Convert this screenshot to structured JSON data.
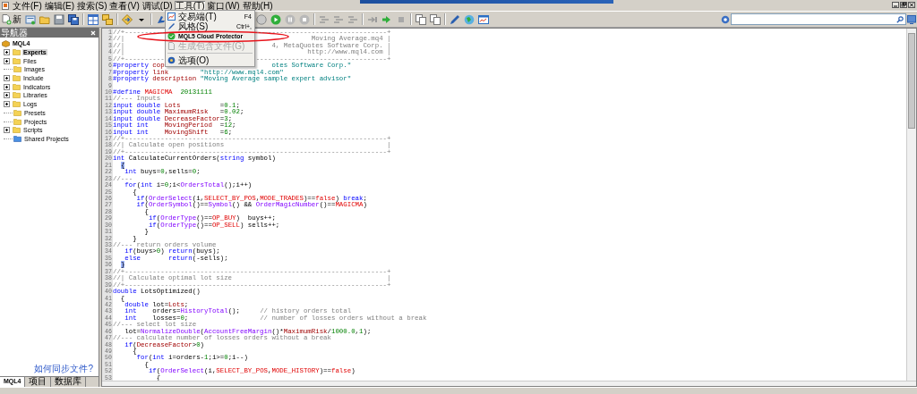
{
  "menu_bar": [
    {
      "label": "文件(F)",
      "selected": false
    },
    {
      "label": "编辑(E)",
      "selected": false
    },
    {
      "label": "搜索(S)",
      "selected": false
    },
    {
      "label": "查看(V)",
      "selected": false
    },
    {
      "label": "调试(D)",
      "selected": false
    },
    {
      "label": "工具(T)",
      "selected": true
    },
    {
      "label": "窗口(W)",
      "selected": false
    },
    {
      "label": "帮助(H)",
      "selected": false
    }
  ],
  "toolbar": {
    "left": [
      {
        "kind": "new-file",
        "label": "新"
      },
      {
        "kind": "new-doc"
      },
      {
        "kind": "folder"
      },
      {
        "kind": "disk"
      },
      {
        "kind": "disks"
      },
      {
        "kind": "separator"
      },
      {
        "kind": "panes"
      },
      {
        "kind": "panes-stack"
      },
      {
        "kind": "separator"
      },
      {
        "kind": "compile"
      },
      {
        "kind": "caret"
      },
      {
        "kind": "separator"
      },
      {
        "kind": "pin"
      }
    ],
    "right": [
      {
        "kind": "circle"
      },
      {
        "kind": "play"
      },
      {
        "kind": "pause"
      },
      {
        "kind": "stop"
      },
      {
        "kind": "separator"
      },
      {
        "kind": "lines"
      },
      {
        "kind": "lines"
      },
      {
        "kind": "lines"
      },
      {
        "kind": "separator"
      },
      {
        "kind": "step"
      },
      {
        "kind": "step-go"
      },
      {
        "kind": "square"
      },
      {
        "kind": "separator"
      },
      {
        "kind": "copy"
      },
      {
        "kind": "copy"
      },
      {
        "kind": "separator"
      },
      {
        "kind": "pen"
      },
      {
        "kind": "globe"
      },
      {
        "kind": "chart-window"
      }
    ]
  },
  "tools_menu": {
    "items": [
      {
        "kind": "item",
        "label": "交易端(T)",
        "shortcut": "F4",
        "disabled": false
      },
      {
        "kind": "item",
        "label": "风格(S)",
        "shortcut": "Ctrl+,",
        "disabled": false
      },
      {
        "kind": "plugin",
        "label": "MQL5 Cloud Protector",
        "disabled": false
      },
      {
        "kind": "item",
        "label": "生成包含文件(G)",
        "disabled": true
      },
      {
        "kind": "separator"
      },
      {
        "kind": "item",
        "label": "选项(O)",
        "disabled": false
      }
    ]
  },
  "navigator": {
    "title": "导航器",
    "root": {
      "label": "MQL4",
      "children": [
        {
          "label": "Experts",
          "kind": "folder",
          "expandable": true,
          "selected": true
        },
        {
          "label": "Files",
          "kind": "folder",
          "expandable": true,
          "selected": false
        },
        {
          "label": "Images",
          "kind": "folder",
          "expandable": false,
          "selected": false
        },
        {
          "label": "Include",
          "kind": "folder",
          "expandable": true,
          "selected": false
        },
        {
          "label": "Indicators",
          "kind": "folder",
          "expandable": true,
          "selected": false
        },
        {
          "label": "Libraries",
          "kind": "folder",
          "expandable": true,
          "selected": false
        },
        {
          "label": "Logs",
          "kind": "folder",
          "expandable": true,
          "selected": false
        },
        {
          "label": "Presets",
          "kind": "folder",
          "expandable": false,
          "selected": false
        },
        {
          "label": "Projects",
          "kind": "folder",
          "expandable": false,
          "selected": false
        },
        {
          "label": "Scripts",
          "kind": "folder",
          "expandable": true,
          "selected": false
        },
        {
          "label": "Shared Projects",
          "kind": "shared",
          "expandable": false,
          "selected": false
        }
      ]
    },
    "link": "如何同步文件?",
    "tabs": [
      {
        "label": "MQL4",
        "selected": true
      },
      {
        "label": "项目",
        "selected": false
      },
      {
        "label": "数据库",
        "selected": false
      }
    ]
  },
  "editor": {
    "lines": [
      {
        "no": "1",
        "code": [
          {
            "kind": "comment",
            "text": "//+----------"
          }
        ],
        "code_right": [
          {
            "kind": "comment",
            "text": "---------------------------------+"
          }
        ]
      },
      {
        "no": "2",
        "code": [
          {
            "kind": "comment",
            "text": "//|"
          }
        ],
        "code_right": [
          {
            "kind": "comment",
            "text": "              Moving Average.mq4 |"
          }
        ]
      },
      {
        "no": "3",
        "code": [
          {
            "kind": "comment",
            "text": "//|"
          }
        ],
        "code_right": [
          {
            "kind": "comment",
            "text": "    4, MetaQuotes Software Corp. |"
          }
        ]
      },
      {
        "no": "4",
        "code": [
          {
            "kind": "comment",
            "text": "//|"
          }
        ],
        "code_right": [
          {
            "kind": "comment",
            "text": "             http://www.mql4.com |"
          }
        ]
      },
      {
        "no": "5",
        "code": [
          {
            "kind": "comment",
            "text": "//+----------"
          }
        ],
        "code_right": [
          {
            "kind": "comment",
            "text": "---------------------------------+"
          }
        ]
      },
      {
        "no": "6",
        "code": [
          {
            "kind": "keyword",
            "text": "#property "
          },
          {
            "kind": "variable",
            "text": "cop"
          }
        ],
        "code_right": [
          {
            "kind": "string",
            "text": "    otes Software Corp.\""
          }
        ]
      },
      {
        "no": "7",
        "code": [
          {
            "kind": "keyword",
            "text": "#property "
          },
          {
            "kind": "variable",
            "text": "link"
          },
          {
            "kind": "string",
            "text": "        \"http://www.mql4.com\""
          }
        ]
      },
      {
        "no": "8",
        "code": [
          {
            "kind": "keyword",
            "text": "#property "
          },
          {
            "kind": "variable",
            "text": "description"
          },
          {
            "kind": "string",
            "text": " \"Moving Average sample expert advisor\""
          }
        ]
      },
      {
        "no": "9"
      },
      {
        "no": "10",
        "code": [
          {
            "kind": "keyword",
            "text": "#define "
          },
          {
            "kind": "constant",
            "text": "MAGICMA"
          },
          {
            "kind": "number",
            "text": "  20131111"
          }
        ]
      },
      {
        "no": "11",
        "code": [
          {
            "kind": "comment",
            "text": "//--- Inputs"
          }
        ]
      },
      {
        "no": "12",
        "code": [
          {
            "kind": "keyword",
            "text": "input double "
          },
          {
            "kind": "variable",
            "text": "Lots"
          },
          {
            "kind": "plain",
            "text": "          ="
          },
          {
            "kind": "number",
            "text": "0.1"
          },
          {
            "kind": "plain",
            "text": ";"
          }
        ]
      },
      {
        "no": "13",
        "code": [
          {
            "kind": "keyword",
            "text": "input double "
          },
          {
            "kind": "variable",
            "text": "MaximumRisk"
          },
          {
            "kind": "plain",
            "text": "   ="
          },
          {
            "kind": "number",
            "text": "0.02"
          },
          {
            "kind": "plain",
            "text": ";"
          }
        ]
      },
      {
        "no": "14",
        "code": [
          {
            "kind": "keyword",
            "text": "input double "
          },
          {
            "kind": "variable",
            "text": "DecreaseFactor"
          },
          {
            "kind": "plain",
            "text": "="
          },
          {
            "kind": "number",
            "text": "3"
          },
          {
            "kind": "plain",
            "text": ";"
          }
        ]
      },
      {
        "no": "15",
        "code": [
          {
            "kind": "keyword",
            "text": "input int    "
          },
          {
            "kind": "variable",
            "text": "MovingPeriod"
          },
          {
            "kind": "plain",
            "text": "  ="
          },
          {
            "kind": "number",
            "text": "12"
          },
          {
            "kind": "plain",
            "text": ";"
          }
        ]
      },
      {
        "no": "16",
        "code": [
          {
            "kind": "keyword",
            "text": "input int    "
          },
          {
            "kind": "variable",
            "text": "MovingShift"
          },
          {
            "kind": "plain",
            "text": "   ="
          },
          {
            "kind": "number",
            "text": "6"
          },
          {
            "kind": "plain",
            "text": ";"
          }
        ]
      },
      {
        "no": "17",
        "code": [
          {
            "kind": "comment",
            "text": "//+------------------------------------------------------------------+"
          }
        ]
      },
      {
        "no": "18",
        "code": [
          {
            "kind": "comment",
            "text": "//| Calculate open positions                                         |"
          }
        ]
      },
      {
        "no": "19",
        "code": [
          {
            "kind": "comment",
            "text": "//+------------------------------------------------------------------+"
          }
        ]
      },
      {
        "no": "20",
        "code": [
          {
            "kind": "keyword",
            "text": "int"
          },
          {
            "kind": "plain",
            "text": " CalculateCurrentOrders("
          },
          {
            "kind": "keyword",
            "text": "string"
          },
          {
            "kind": "plain",
            "text": " symbol)"
          }
        ]
      },
      {
        "no": "21",
        "code": [
          {
            "kind": "brace",
            "text": "  {"
          }
        ]
      },
      {
        "no": "22",
        "code": [
          {
            "kind": "keyword",
            "text": "   int"
          },
          {
            "kind": "plain",
            "text": " buys="
          },
          {
            "kind": "number",
            "text": "0"
          },
          {
            "kind": "plain",
            "text": ",sells="
          },
          {
            "kind": "number",
            "text": "0"
          },
          {
            "kind": "plain",
            "text": ";"
          }
        ]
      },
      {
        "no": "23",
        "code": [
          {
            "kind": "comment",
            "text": "//---"
          }
        ]
      },
      {
        "no": "24",
        "code": [
          {
            "kind": "keyword",
            "text": "   for"
          },
          {
            "kind": "plain",
            "text": "("
          },
          {
            "kind": "keyword",
            "text": "int"
          },
          {
            "kind": "plain",
            "text": " i="
          },
          {
            "kind": "number",
            "text": "0"
          },
          {
            "kind": "plain",
            "text": ";i<"
          },
          {
            "kind": "function",
            "text": "OrdersTotal"
          },
          {
            "kind": "plain",
            "text": "();i++)"
          }
        ]
      },
      {
        "no": "25",
        "code": [
          {
            "kind": "plain",
            "text": "     {"
          }
        ]
      },
      {
        "no": "26",
        "code": [
          {
            "kind": "keyword",
            "text": "      if"
          },
          {
            "kind": "plain",
            "text": "("
          },
          {
            "kind": "function",
            "text": "OrderSelect"
          },
          {
            "kind": "plain",
            "text": "(i,"
          },
          {
            "kind": "constant",
            "text": "SELECT_BY_POS"
          },
          {
            "kind": "plain",
            "text": ","
          },
          {
            "kind": "constant",
            "text": "MODE_TRADES"
          },
          {
            "kind": "plain",
            "text": ")=="
          },
          {
            "kind": "constant",
            "text": "false"
          },
          {
            "kind": "plain",
            "text": ") "
          },
          {
            "kind": "keyword",
            "text": "break"
          },
          {
            "kind": "plain",
            "text": ";"
          }
        ]
      },
      {
        "no": "27",
        "code": [
          {
            "kind": "keyword",
            "text": "      if"
          },
          {
            "kind": "plain",
            "text": "("
          },
          {
            "kind": "function",
            "text": "OrderSymbol"
          },
          {
            "kind": "plain",
            "text": "()=="
          },
          {
            "kind": "function",
            "text": "Symbol"
          },
          {
            "kind": "plain",
            "text": "() && "
          },
          {
            "kind": "function",
            "text": "OrderMagicNumber"
          },
          {
            "kind": "plain",
            "text": "()=="
          },
          {
            "kind": "constant",
            "text": "MAGICMA"
          },
          {
            "kind": "plain",
            "text": ")"
          }
        ]
      },
      {
        "no": "28",
        "code": [
          {
            "kind": "plain",
            "text": "        {"
          }
        ]
      },
      {
        "no": "29",
        "code": [
          {
            "kind": "keyword",
            "text": "         if"
          },
          {
            "kind": "plain",
            "text": "("
          },
          {
            "kind": "function",
            "text": "OrderType"
          },
          {
            "kind": "plain",
            "text": "()=="
          },
          {
            "kind": "constant",
            "text": "OP_BUY"
          },
          {
            "kind": "plain",
            "text": ")  buys++;"
          }
        ]
      },
      {
        "no": "30",
        "code": [
          {
            "kind": "keyword",
            "text": "         if"
          },
          {
            "kind": "plain",
            "text": "("
          },
          {
            "kind": "function",
            "text": "OrderType"
          },
          {
            "kind": "plain",
            "text": "()=="
          },
          {
            "kind": "constant",
            "text": "OP_SELL"
          },
          {
            "kind": "plain",
            "text": ") sells++;"
          }
        ]
      },
      {
        "no": "31",
        "code": [
          {
            "kind": "plain",
            "text": "        }"
          }
        ]
      },
      {
        "no": "32",
        "code": [
          {
            "kind": "plain",
            "text": "     }"
          }
        ]
      },
      {
        "no": "33",
        "code": [
          {
            "kind": "comment",
            "text": "//--- return orders volume"
          }
        ]
      },
      {
        "no": "34",
        "code": [
          {
            "kind": "keyword",
            "text": "   if"
          },
          {
            "kind": "plain",
            "text": "(buys>"
          },
          {
            "kind": "number",
            "text": "0"
          },
          {
            "kind": "plain",
            "text": ") "
          },
          {
            "kind": "keyword",
            "text": "return"
          },
          {
            "kind": "plain",
            "text": "(buys);"
          }
        ]
      },
      {
        "no": "35",
        "code": [
          {
            "kind": "keyword",
            "text": "   else"
          },
          {
            "kind": "keyword",
            "text": "       return"
          },
          {
            "kind": "plain",
            "text": "(-sells);"
          }
        ]
      },
      {
        "no": "36",
        "code": [
          {
            "kind": "brace",
            "text": "  }"
          }
        ]
      },
      {
        "no": "37",
        "code": [
          {
            "kind": "comment",
            "text": "//+------------------------------------------------------------------+"
          }
        ]
      },
      {
        "no": "38",
        "code": [
          {
            "kind": "comment",
            "text": "//| Calculate optimal lot size                                       |"
          }
        ]
      },
      {
        "no": "39",
        "code": [
          {
            "kind": "comment",
            "text": "//+------------------------------------------------------------------+"
          }
        ]
      },
      {
        "no": "40",
        "code": [
          {
            "kind": "keyword",
            "text": "double"
          },
          {
            "kind": "plain",
            "text": " LotsOptimized()"
          }
        ]
      },
      {
        "no": "41",
        "code": [
          {
            "kind": "plain",
            "text": "  {"
          }
        ]
      },
      {
        "no": "42",
        "code": [
          {
            "kind": "keyword",
            "text": "   double"
          },
          {
            "kind": "plain",
            "text": " lot="
          },
          {
            "kind": "variable",
            "text": "Lots"
          },
          {
            "kind": "plain",
            "text": ";"
          }
        ]
      },
      {
        "no": "43",
        "code": [
          {
            "kind": "keyword",
            "text": "   int"
          },
          {
            "kind": "plain",
            "text": "    orders="
          },
          {
            "kind": "function",
            "text": "HistoryTotal"
          },
          {
            "kind": "plain",
            "text": "();"
          },
          {
            "kind": "comment",
            "text": "     // history orders total"
          }
        ]
      },
      {
        "no": "44",
        "code": [
          {
            "kind": "keyword",
            "text": "   int"
          },
          {
            "kind": "plain",
            "text": "    losses="
          },
          {
            "kind": "number",
            "text": "0"
          },
          {
            "kind": "plain",
            "text": ";"
          },
          {
            "kind": "comment",
            "text": "                  // number of losses orders without a break"
          }
        ]
      },
      {
        "no": "45",
        "code": [
          {
            "kind": "comment",
            "text": "//--- select lot size"
          }
        ]
      },
      {
        "no": "46",
        "code": [
          {
            "kind": "plain",
            "text": "   lot="
          },
          {
            "kind": "function",
            "text": "NormalizeDouble"
          },
          {
            "kind": "plain",
            "text": "("
          },
          {
            "kind": "function",
            "text": "AccountFreeMargin"
          },
          {
            "kind": "plain",
            "text": "()*"
          },
          {
            "kind": "variable",
            "text": "MaximumRisk"
          },
          {
            "kind": "plain",
            "text": "/"
          },
          {
            "kind": "number",
            "text": "1000.0"
          },
          {
            "kind": "plain",
            "text": ","
          },
          {
            "kind": "number",
            "text": "1"
          },
          {
            "kind": "plain",
            "text": ");"
          }
        ]
      },
      {
        "no": "47",
        "code": [
          {
            "kind": "comment",
            "text": "//--- calculate number of losses orders without a break"
          }
        ]
      },
      {
        "no": "48",
        "code": [
          {
            "kind": "keyword",
            "text": "   if"
          },
          {
            "kind": "plain",
            "text": "("
          },
          {
            "kind": "variable",
            "text": "DecreaseFactor"
          },
          {
            "kind": "plain",
            "text": ">"
          },
          {
            "kind": "number",
            "text": "0"
          },
          {
            "kind": "plain",
            "text": ")"
          }
        ]
      },
      {
        "no": "49",
        "code": [
          {
            "kind": "plain",
            "text": "     {"
          }
        ]
      },
      {
        "no": "50",
        "code": [
          {
            "kind": "keyword",
            "text": "      for"
          },
          {
            "kind": "plain",
            "text": "("
          },
          {
            "kind": "keyword",
            "text": "int"
          },
          {
            "kind": "plain",
            "text": " i=orders-"
          },
          {
            "kind": "number",
            "text": "1"
          },
          {
            "kind": "plain",
            "text": ";i>="
          },
          {
            "kind": "number",
            "text": "0"
          },
          {
            "kind": "plain",
            "text": ";i--)"
          }
        ]
      },
      {
        "no": "51",
        "code": [
          {
            "kind": "plain",
            "text": "        {"
          }
        ]
      },
      {
        "no": "52",
        "code": [
          {
            "kind": "keyword",
            "text": "         if"
          },
          {
            "kind": "plain",
            "text": "("
          },
          {
            "kind": "function",
            "text": "OrderSelect"
          },
          {
            "kind": "plain",
            "text": "(i,"
          },
          {
            "kind": "constant",
            "text": "SELECT_BY_POS"
          },
          {
            "kind": "plain",
            "text": ","
          },
          {
            "kind": "constant",
            "text": "MODE_HISTORY"
          },
          {
            "kind": "plain",
            "text": ")=="
          },
          {
            "kind": "constant",
            "text": "false"
          },
          {
            "kind": "plain",
            "text": ")"
          }
        ]
      },
      {
        "no": "53",
        "code": [
          {
            "kind": "plain",
            "text": "           {"
          }
        ]
      }
    ]
  }
}
